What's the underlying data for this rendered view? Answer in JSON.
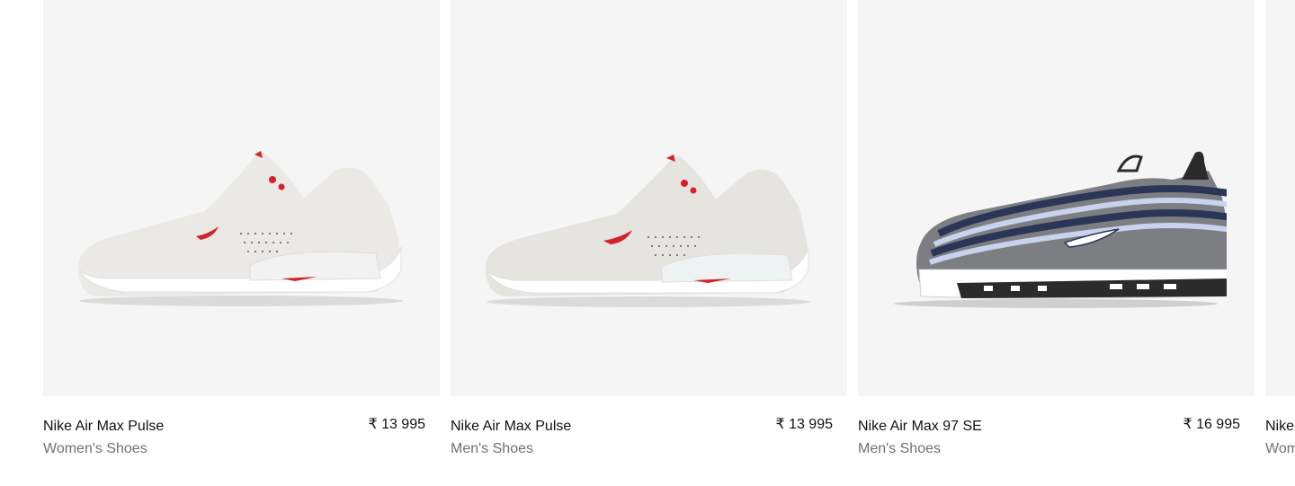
{
  "products": [
    {
      "name": "Nike Air Max Pulse",
      "category": "Women's Shoes",
      "price": "₹ 13 995",
      "image_icon": "white-red-sneaker-image",
      "colors": {
        "upper": "#e9e7e4",
        "sole": "#ffffff",
        "accent": "#d3222a",
        "shadow": "#d8d8d8"
      }
    },
    {
      "name": "Nike Air Max Pulse",
      "category": "Men's Shoes",
      "price": "₹ 13 995",
      "image_icon": "white-red-sneaker-image",
      "colors": {
        "upper": "#e4e2de",
        "sole": "#ffffff",
        "accent": "#d3222a",
        "shadow": "#d8d8d8"
      }
    },
    {
      "name": "Nike Air Max 97 SE",
      "category": "Men's Shoes",
      "price": "₹ 16 995",
      "image_icon": "navy-grey-sneaker-image",
      "colors": {
        "upper": "#7c7d80",
        "stripe": "#2a3558",
        "light": "#c9d3ee",
        "sole": "#ffffff",
        "shadow": "#2b2b2b"
      }
    },
    {
      "name": "Nike",
      "category": "Wom",
      "price": "",
      "image_icon": "sneaker-image",
      "colors": {}
    }
  ],
  "page": {
    "background": "#f5f5f5",
    "text_primary": "#111111",
    "text_secondary": "#707072"
  }
}
